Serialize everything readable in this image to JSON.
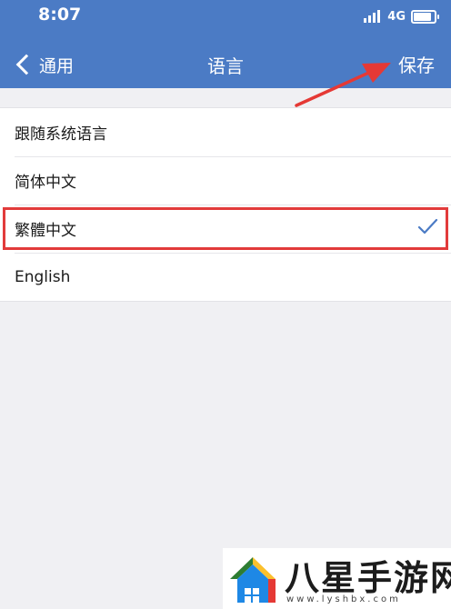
{
  "status_bar": {
    "time": "8:07",
    "network": "4G",
    "battery_level": 0.85
  },
  "nav": {
    "back_label": "通用",
    "title": "语言",
    "save_label": "保存"
  },
  "languages": [
    {
      "label": "跟随系统语言",
      "selected": false
    },
    {
      "label": "简体中文",
      "selected": false
    },
    {
      "label": "繁體中文",
      "selected": true
    },
    {
      "label": "English",
      "selected": false
    }
  ],
  "watermark": {
    "brand": "八星手游网",
    "url": "www.lyshbx.com"
  },
  "colors": {
    "header_bg": "#4b7bc5",
    "page_bg": "#f0f0f3",
    "highlight": "#e23b3b",
    "checkmark": "#4b7bc5"
  },
  "icons": {
    "back": "chevron-left-icon",
    "selected": "checkmark-icon",
    "annotation": "red-arrow-icon"
  }
}
